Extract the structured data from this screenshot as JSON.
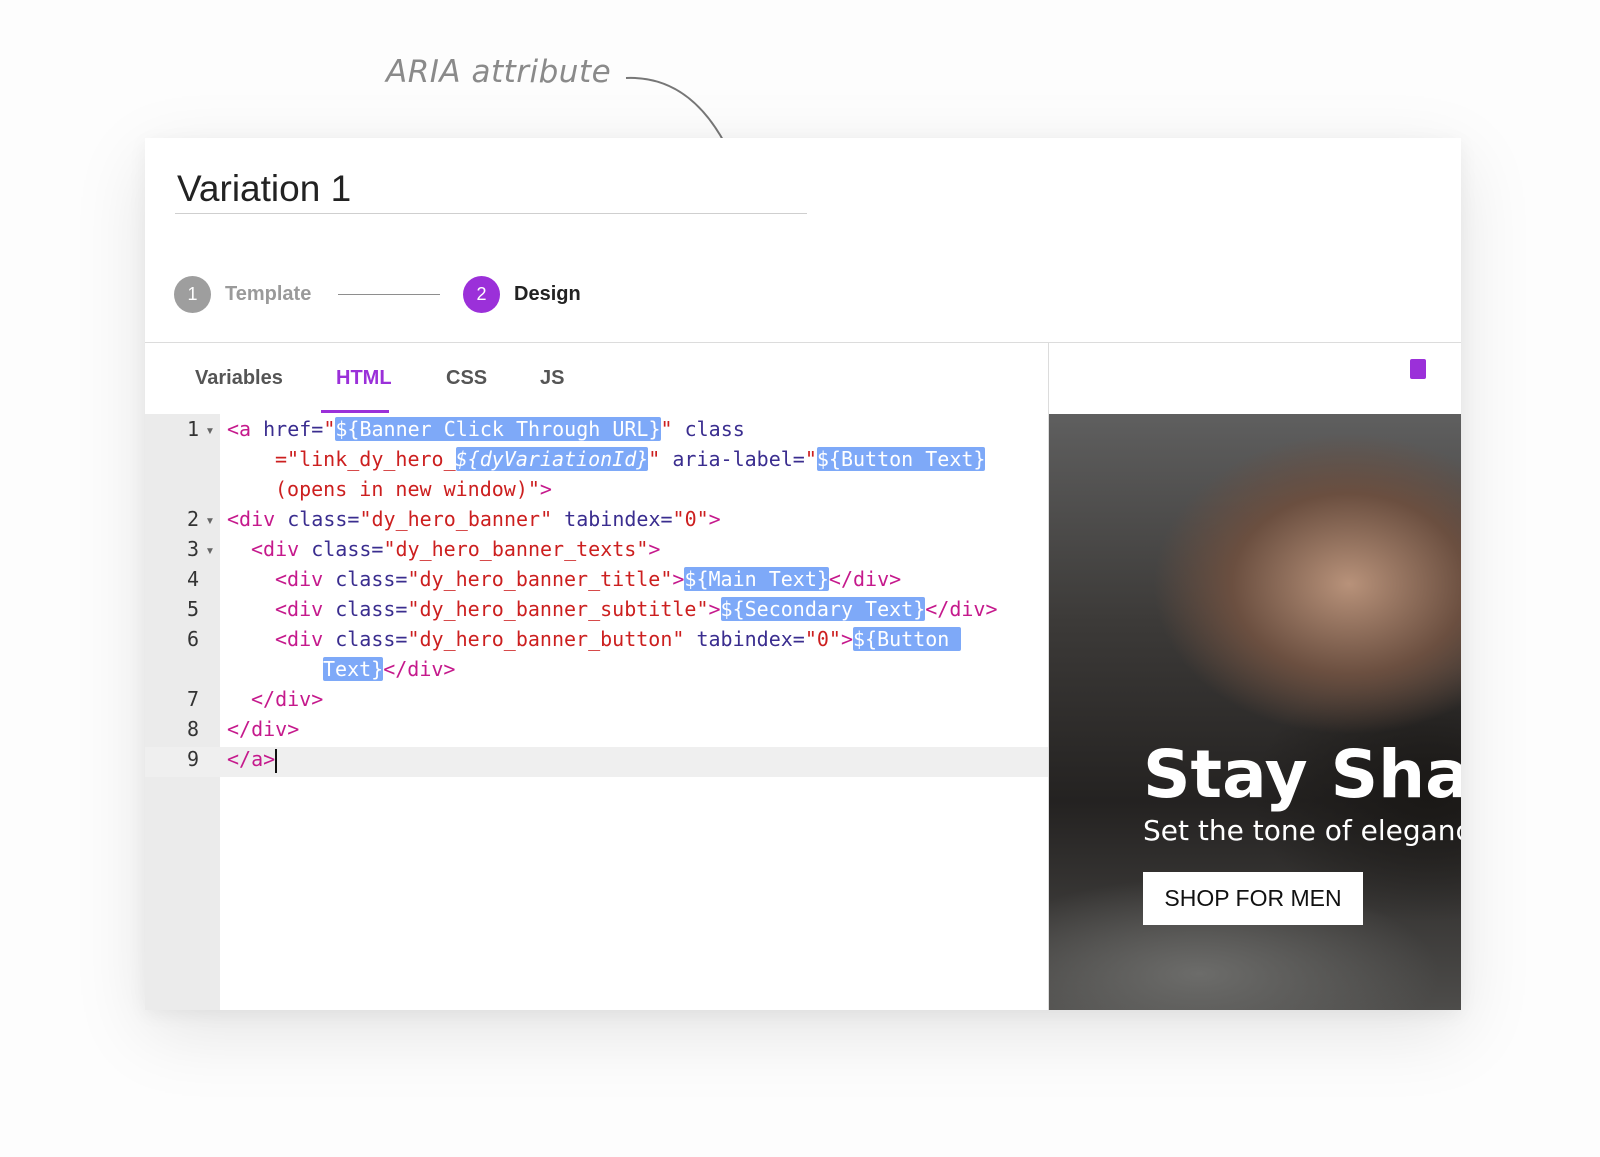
{
  "annotation": {
    "text": "ARIA attribute"
  },
  "header": {
    "title": "Variation 1"
  },
  "steps": [
    {
      "number": "1",
      "label": "Template",
      "state": "inactive"
    },
    {
      "number": "2",
      "label": "Design",
      "state": "active"
    }
  ],
  "tabs": [
    {
      "label": "Variables",
      "active": false
    },
    {
      "label": "HTML",
      "active": true
    },
    {
      "label": "CSS",
      "active": false
    },
    {
      "label": "JS",
      "active": false
    }
  ],
  "editor": {
    "language": "HTML",
    "active_line": 9,
    "line_numbers": [
      "1",
      "2",
      "3",
      "4",
      "5",
      "6",
      "7",
      "8",
      "9"
    ],
    "lines": [
      "<a href=\"${Banner Click Through URL}\" class=\"link_dy_hero_${dyVariationId}\" aria-label=\"${Button Text} (opens in new window)\">",
      "<div class=\"dy_hero_banner\" tabindex=\"0\">",
      "  <div class=\"dy_hero_banner_texts\">",
      "    <div class=\"dy_hero_banner_title\">${Main Text}</div>",
      "    <div class=\"dy_hero_banner_subtitle\">${Secondary Text}</div>",
      "    <div class=\"dy_hero_banner_button\" tabindex=\"0\">${Button Text}</div>",
      "  </div>",
      "</div>",
      "</a>"
    ],
    "tokens": {
      "l1a": "<a",
      "l1b": " href=",
      "l1c": "\"",
      "l1d": "${Banner Click Through URL}",
      "l1e": "\"",
      "l1f": " class",
      "l1g": "=\"link_dy_hero_",
      "l1h": "${dyVariationId}",
      "l1i": "\"",
      "l1j": " aria-label=",
      "l1k": "\"",
      "l1l": "${Button Text}",
      "l1m": "(opens in new window)\"",
      "l1n": ">",
      "l2a": "<div",
      "l2b": " class=",
      "l2c": "\"dy_hero_banner\"",
      "l2d": " tabindex=",
      "l2e": "\"0\"",
      "l2f": ">",
      "l3a": "<div",
      "l3b": " class=",
      "l3c": "\"dy_hero_banner_texts\"",
      "l3d": ">",
      "l4a": "<div",
      "l4b": " class=",
      "l4c": "\"dy_hero_banner_title\"",
      "l4d": ">",
      "l4e": "${Main Text}",
      "l4f": "</div>",
      "l5a": "<div",
      "l5b": " class=",
      "l5c": "\"dy_hero_banner_subtitle\"",
      "l5d": ">",
      "l5e": "${Secondary Text}",
      "l5f": "</div>",
      "l6a": "<div",
      "l6b": " class=",
      "l6c": "\"dy_hero_banner_button\"",
      "l6d": " tabindex=",
      "l6e": "\"0\"",
      "l6f": ">",
      "l6g": "${Button ",
      "l6h": "Text}",
      "l6i": "</div>",
      "l7a": "</div>",
      "l8a": "</div>",
      "l9a": "</a>"
    }
  },
  "preview": {
    "main_text": "Stay Sharp",
    "secondary_text": "Set the tone of elegance",
    "button_text": "SHOP FOR MEN"
  },
  "colors": {
    "accent": "#9b30d9",
    "highlight": "#7ea9f8",
    "tag": "#c5198c",
    "attribute": "#3a2d8f",
    "string": "#cc1f1f"
  }
}
